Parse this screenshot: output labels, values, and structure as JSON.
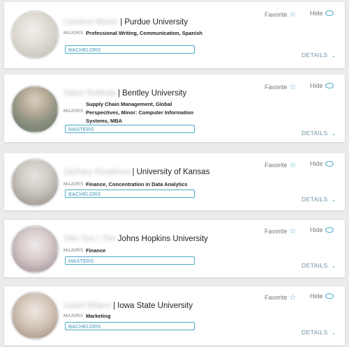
{
  "actions": {
    "favorite_label": "Favorite",
    "hide_label": "Hide",
    "details_label": "DETAILS",
    "majors_label": "MAJORS"
  },
  "icons": {
    "favorite": "star-outline-icon",
    "hide": "eye-icon",
    "details": "chevron-down-icon",
    "accent_color": "#4aa9c8"
  },
  "cards": [
    {
      "name": "Caroline Martin",
      "university": "| Purdue University",
      "majors": "Professional Writing, Communication, Spanish",
      "degree": "BACHELORS"
    },
    {
      "name": "Adam Rokkola",
      "university": "| Bentley University",
      "majors": "Supply Chain Management, Global Perspectives, Minor: Computer Information Systems, MBA",
      "degree": "MASTERS"
    },
    {
      "name": "Zachary Kiryakova",
      "university": "| University of Kansas",
      "majors": "Finance, Concentration in Data Analytics",
      "degree": "BACHELORS"
    },
    {
      "name": "Yifei Sun | The",
      "university": "Johns Hopkins University",
      "majors": "Finance",
      "degree": "MASTERS"
    },
    {
      "name": "Isabel Milano",
      "university": "| Iowa State University",
      "majors": "Marketing",
      "degree": "BACHELORS"
    }
  ]
}
